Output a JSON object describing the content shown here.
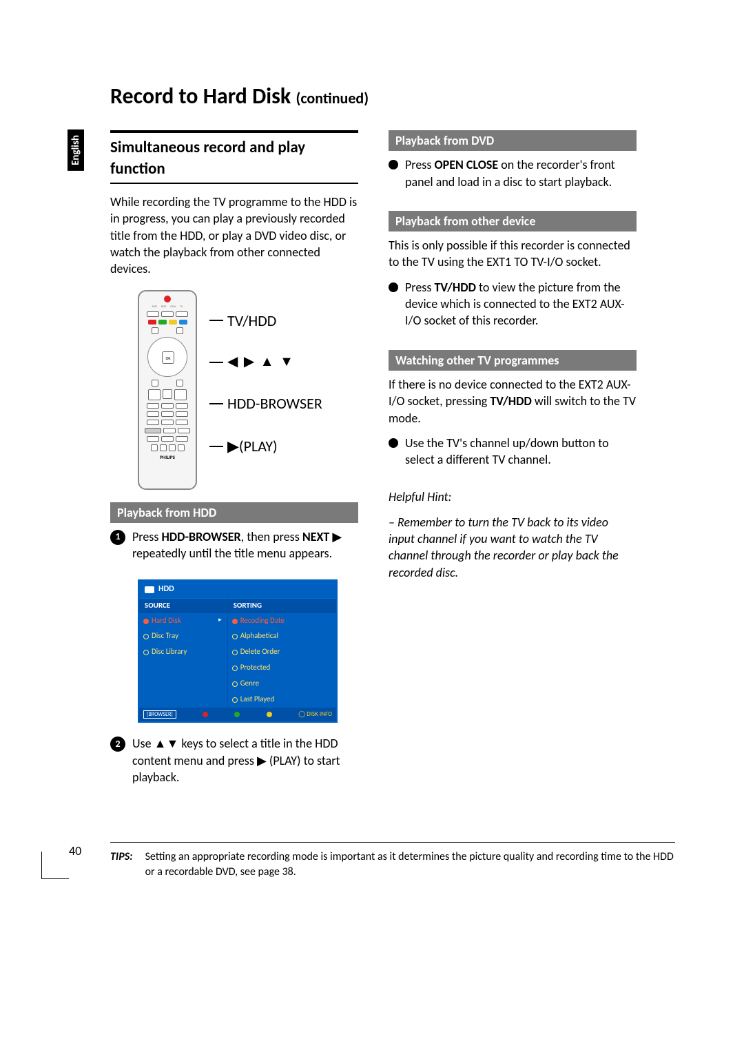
{
  "language_tab": "English",
  "title_main": "Record to Hard Disk",
  "title_cont": "(continued)",
  "left": {
    "section_heading": "Simultaneous record and play function",
    "intro": "While recording the TV programme to the HDD is in progress, you can play a previously recorded title from the HDD, or play a DVD video disc, or watch the playback from other connected devices.",
    "remote_labels": {
      "l1": "TV/HDD",
      "l2_arrows": "◀ ▶ ▲ ▼",
      "l3": "HDD-BROWSER",
      "l4": "▶(PLAY)"
    },
    "sub1": "Playback from HDD",
    "step1_pre": "Press ",
    "step1_b1": "HDD-BROWSER",
    "step1_mid": ", then press ",
    "step1_b2": "NEXT",
    "step1_arrow": " ▶ ",
    "step1_post": " repeatedly until the title menu appears.",
    "browser": {
      "title": "HDD",
      "col_source": "SOURCE",
      "col_sorting": "SORTING",
      "src_items": [
        "Hard Disk",
        "Disc Tray",
        "Disc Library"
      ],
      "sort_items": [
        "Recoding Date",
        "Alphabetical",
        "Delete Order",
        "Protected",
        "Genre",
        "Last Played"
      ],
      "footer_tag": "[BROWSER]",
      "footer_info": "DISK INFO"
    },
    "step2_pre": "Use ",
    "step2_arrows": "▲▼",
    "step2_mid": " keys to select a title in the HDD content menu and press ",
    "step2_play": "▶",
    "step2_post": " (PLAY) to start playback."
  },
  "right": {
    "sub1": "Playback from DVD",
    "dvd_pre": "Press ",
    "dvd_b": "OPEN CLOSE",
    "dvd_post": " on the recorder's front panel and load in a disc to start playback.",
    "sub2": "Playback from other device",
    "other_p1": "This is only possible if this recorder is connected to the TV using the EXT1 TO TV-I/O socket.",
    "other_b2_pre": "Press ",
    "other_b2_b": "TV/HDD",
    "other_b2_post": " to view the picture from the device which is connected to the EXT2 AUX-I/O socket of this recorder.",
    "sub3": "Watching other TV programmes",
    "watch_p1_pre": "If there is no device connected to the EXT2 AUX-I/O socket, pressing ",
    "watch_p1_b": "TV/HDD",
    "watch_p1_post": " will switch to the TV mode.",
    "watch_b2": "Use the TV's channel up/down button to select a different TV channel.",
    "hint_label": "Helpful Hint:",
    "hint_body": "– Remember to turn the TV back to its video input channel if you want to watch the TV channel through the recorder or play back the recorded disc."
  },
  "tips_label": "TIPS:",
  "tips_body": "Setting an appropriate recording mode is important as it determines the picture quality and recording time to the HDD or a recordable DVD, see page 38.",
  "page_number": "40"
}
